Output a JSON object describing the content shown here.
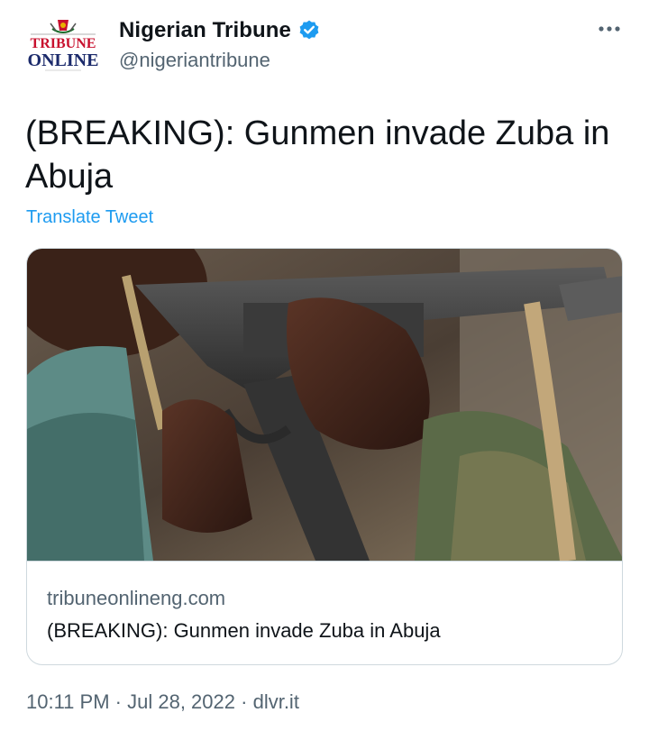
{
  "account": {
    "display_name": "Nigerian Tribune",
    "handle": "@nigeriantribune",
    "verified": true,
    "avatar_lines": [
      "TRIBUNE",
      "ONLINE"
    ]
  },
  "tweet": {
    "text": "(BREAKING): Gunmen invade Zuba in Abuja",
    "translate_label": "Translate Tweet"
  },
  "card": {
    "domain": "tribuneonlineng.com",
    "title": "(BREAKING): Gunmen invade Zuba in Abuja"
  },
  "meta": {
    "time": "10:11 PM",
    "separator": "·",
    "date": "Jul 28, 2022",
    "source": "dlvr.it"
  },
  "colors": {
    "accent": "#1d9bf0",
    "text_primary": "#0f1419",
    "text_secondary": "#536471",
    "border": "#cfd9de",
    "logo_red": "#c8102e",
    "logo_navy": "#1b2a6b"
  }
}
